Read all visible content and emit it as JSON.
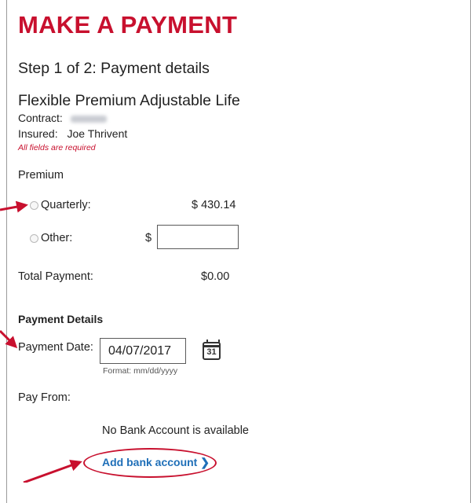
{
  "page": {
    "title": "MAKE A PAYMENT",
    "step": "Step 1 of 2: Payment details",
    "product": "Flexible Premium Adjustable Life"
  },
  "contract": {
    "label": "Contract:"
  },
  "insured": {
    "label": "Insured:",
    "value": "Joe Thrivent"
  },
  "required_note": "All fields are required",
  "premium": {
    "heading": "Premium",
    "quarterly": {
      "label": "Quarterly:",
      "amount": "$ 430.14"
    },
    "other": {
      "label": "Other:",
      "currency": "$",
      "value": ""
    }
  },
  "total": {
    "label": "Total Payment:",
    "value": "$0.00"
  },
  "details": {
    "heading": "Payment Details",
    "date_label": "Payment Date:",
    "date_value": "04/07/2017",
    "date_format": "Format: mm/dd/yyyy",
    "calendar_day": "31"
  },
  "pay_from": {
    "label": "Pay From:",
    "empty_message": "No Bank Account is available",
    "add_link": "Add bank account ❯"
  },
  "colors": {
    "brand_red": "#c8102e",
    "link_blue": "#1f6fb8"
  }
}
